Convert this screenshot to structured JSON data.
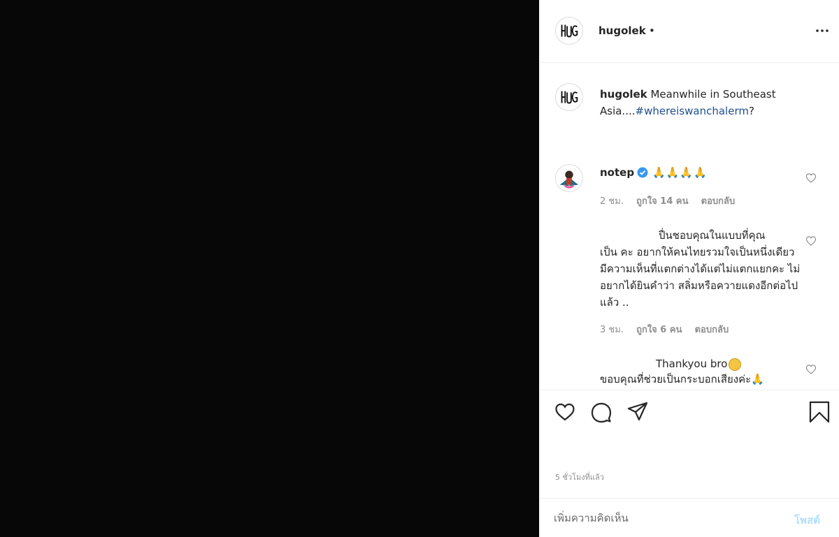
{
  "post": {
    "author": "hugolek",
    "header_dot": "•",
    "caption_text": "Meanwhile in Southeast Asia....",
    "caption_hashtag": "#whereiswanchalerm",
    "caption_end": "?"
  },
  "comments": [
    {
      "username": "notep",
      "text": "🙏🙏🙏🙏",
      "time": "2 ชม.",
      "likes": "ถูกใจ 14 คน",
      "reply": "ตอบกลับ"
    },
    {
      "line1": "ปื่นชอบคุณในแบบที่คุณ",
      "rest": "เป็น คะ อยากให้คนไทยรวมใจเป็นหนึ่งเดียว มีความเห็นที่แตกต่างได้แต่ไม่แตกแยกคะ ไม่อยากได้ยินคำว่า สลิ่มหรือควายแดงอีกต่อไปแล้ว ..",
      "time": "3 ชม.",
      "likes": "ถูกใจ 6 คน",
      "reply": "ตอบกลับ"
    },
    {
      "line1": "Thankyou bro",
      "line2": "ขอบคุณที่ช่วยเป็นกระบอกเสียงค่ะ",
      "hand_emoji": "🙏"
    }
  ],
  "timestamp": "5 ชั่วโมงที่แล้ว",
  "add_comment": {
    "placeholder": "เพิ่มความคิดเห็น",
    "post_label": "โพสต์"
  },
  "colors": {
    "link": "#1d4f91",
    "verified": "#3897f0",
    "post_disabled": "#b2dffc"
  }
}
